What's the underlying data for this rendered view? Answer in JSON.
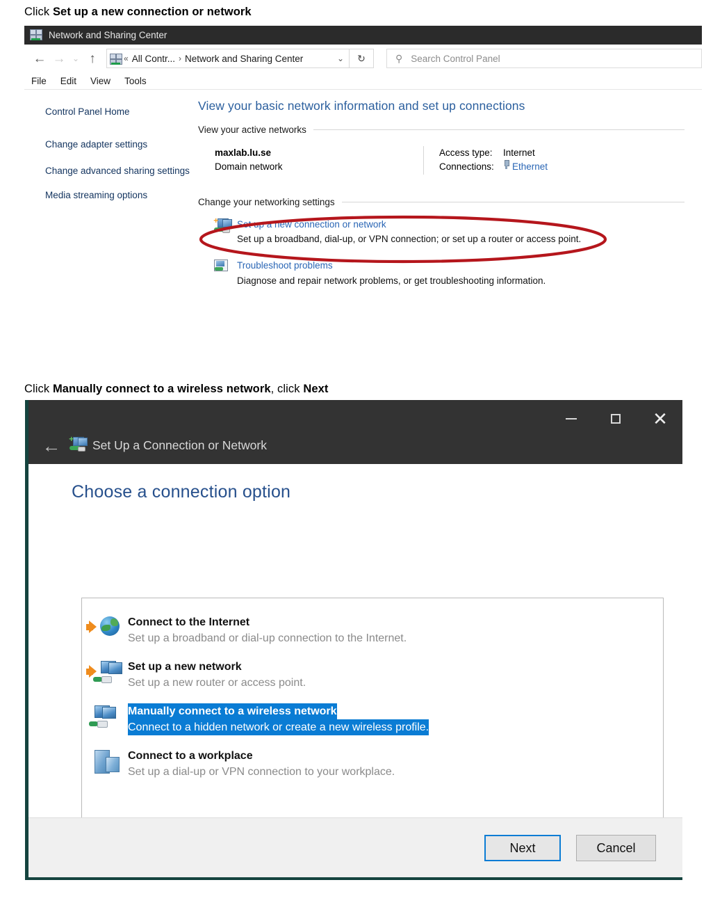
{
  "instructions": {
    "step1_prefix": "Click ",
    "step1_bold": "Set up a new connection or network",
    "step2_prefix": "Click ",
    "step2_bold": "Manually connect to a wireless network",
    "step2_mid": ", click ",
    "step2_bold2": "Next"
  },
  "control_panel": {
    "title": "Network and Sharing Center",
    "title_icon": "network-icon",
    "nav": {
      "back": "←",
      "forward": "→",
      "history": "⌄",
      "up": "↑"
    },
    "address": {
      "icon": "network-icon",
      "chevrons": "«",
      "segment1": "All Contr...",
      "separator": "›",
      "segment2": "Network and Sharing Center",
      "dropdown": "⌄"
    },
    "refresh": "↻",
    "search": {
      "icon": "search-icon",
      "placeholder": "Search Control Panel",
      "value": ""
    },
    "menu": [
      "File",
      "Edit",
      "View",
      "Tools"
    ],
    "sidebar": [
      "Control Panel Home",
      "Change adapter settings",
      "Change advanced sharing settings",
      "Media streaming options"
    ],
    "main": {
      "heading": "View your basic network information and set up connections",
      "active_networks_label": "View your active networks",
      "network": {
        "name": "maxlab.lu.se",
        "type": "Domain network",
        "access_type_label": "Access type:",
        "access_type_value": "Internet",
        "connections_label": "Connections:",
        "connections_value": "Ethernet",
        "connections_icon": "ethernet-plug-icon"
      },
      "change_settings_label": "Change your networking settings",
      "tasks": [
        {
          "icon": "setup-connection-icon",
          "link": "Set up a new connection or network",
          "desc": "Set up a broadband, dial-up, or VPN connection; or set up a router or access point."
        },
        {
          "icon": "troubleshoot-icon",
          "link": "Troubleshoot problems",
          "desc": "Diagnose and repair network problems, or get troubleshooting information."
        }
      ]
    },
    "annotation": {
      "shape": "red-ellipse",
      "color": "#b5161c"
    }
  },
  "wizard": {
    "title": "Set Up a Connection or Network",
    "title_icon": "setup-connection-icon",
    "back_button": "←",
    "window_controls": {
      "minimize": "minimize-icon",
      "maximize": "maximize-icon",
      "close": "close-icon"
    },
    "heading": "Choose a connection option",
    "options": [
      {
        "icon": "connect-internet-icon",
        "title": "Connect to the Internet",
        "desc": "Set up a broadband or dial-up connection to the Internet.",
        "selected": false
      },
      {
        "icon": "setup-new-network-icon",
        "title": "Set up a new network",
        "desc": "Set up a new router or access point.",
        "selected": false
      },
      {
        "icon": "wireless-network-icon",
        "title": "Manually connect to a wireless network",
        "desc": "Connect to a hidden network or create a new wireless profile.",
        "selected": true
      },
      {
        "icon": "workplace-icon",
        "title": "Connect to a workplace",
        "desc": "Set up a dial-up or VPN connection to your workplace.",
        "selected": false
      }
    ],
    "buttons": {
      "next": "Next",
      "cancel": "Cancel"
    },
    "colors": {
      "selection": "#0a7cd4",
      "heading": "#27508c",
      "border": "#15443f"
    }
  }
}
